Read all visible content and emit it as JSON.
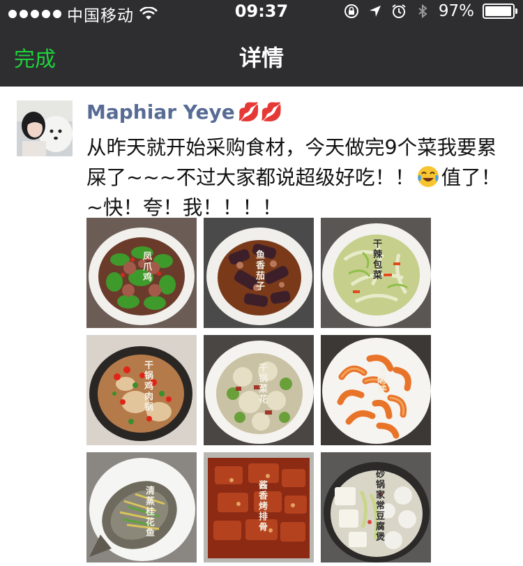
{
  "status_bar": {
    "carrier": "中国移动",
    "time": "09:37",
    "battery_percent": "97%",
    "battery_level": 0.97
  },
  "nav": {
    "done_label": "完成",
    "title": "详情"
  },
  "post": {
    "username": "Maphiar Yeye",
    "username_emoji": "💋💋",
    "text_part1": "从昨天就开始采购食材，今天做完9个菜我要累屎了~~~不过大家都说超级好吃！！",
    "text_part2": "值了！~快！夸！我！！！！",
    "photos": [
      {
        "caption": "凤爪鸡"
      },
      {
        "caption": "鱼香茄子"
      },
      {
        "caption": "干辣包菜"
      },
      {
        "caption": "干锅鸡肉锅"
      },
      {
        "caption": "干锅菜花"
      },
      {
        "caption": "油焖虾"
      },
      {
        "caption": "清蒸桂花鱼"
      },
      {
        "caption": "酱香烤排骨"
      },
      {
        "caption": "砂锅家常豆腐煲"
      }
    ]
  },
  "colors": {
    "bar_bg": "#2e2e31",
    "done_green": "#1ed33c",
    "username_blue": "#576b95"
  }
}
